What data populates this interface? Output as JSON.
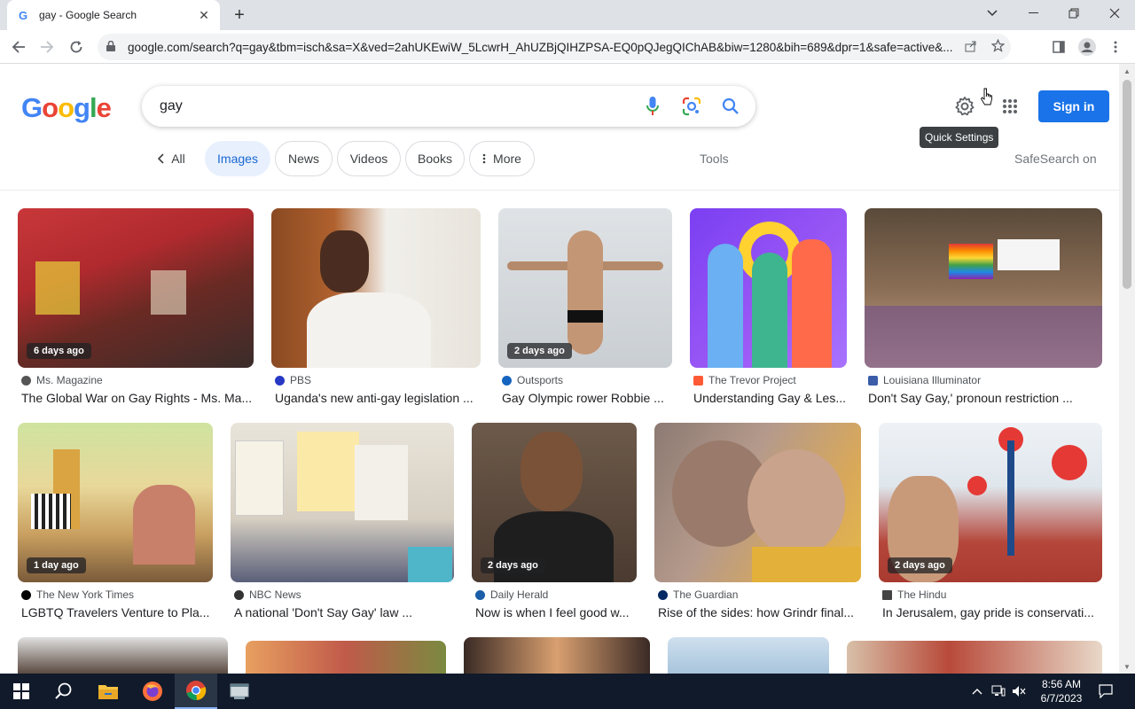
{
  "browser": {
    "tab_title": "gay - Google Search",
    "favicon": "G",
    "new_tab": "+",
    "url": "google.com/search?q=gay&tbm=isch&sa=X&ved=2ahUKEwiW_5LcwrH_AhUZBjQIHZPSA-EQ0pQJegQIChAB&biw=1280&bih=689&dpr=1&safe=active&..."
  },
  "header": {
    "logo_letters": [
      "G",
      "o",
      "o",
      "g",
      "l",
      "e"
    ],
    "logo_colors": [
      "#4285f4",
      "#ea4335",
      "#fbbc05",
      "#4285f4",
      "#34a853",
      "#ea4335"
    ],
    "search_value": "gay",
    "signin_label": "Sign in",
    "tooltip": "Quick Settings"
  },
  "filters": {
    "all": "All",
    "images": "Images",
    "news": "News",
    "videos": "Videos",
    "books": "Books",
    "more": "More",
    "tools": "Tools",
    "safesearch": "SafeSearch on"
  },
  "results": [
    {
      "age": "6 days ago",
      "source": "Ms. Magazine",
      "title": "The Global War on Gay Rights - Ms. Ma...",
      "icon_color": "#555555"
    },
    {
      "age": "",
      "source": "PBS",
      "title": "Uganda's new anti-gay legislation ...",
      "icon_color": "#2638c4"
    },
    {
      "age": "2 days ago",
      "source": "Outsports",
      "title": "Gay Olympic rower Robbie ...",
      "icon_color": "#1565c0"
    },
    {
      "age": "",
      "source": "The Trevor Project",
      "title": "Understanding Gay & Les...",
      "icon_color": "#ff5a36"
    },
    {
      "age": "",
      "source": "Louisiana Illuminator",
      "title": "Don't Say Gay,' pronoun restriction ...",
      "icon_color": "#3b5ca8"
    },
    {
      "age": "1 day ago",
      "source": "The New York Times",
      "title": "LGBTQ Travelers Venture to Pla...",
      "icon_color": "#000000"
    },
    {
      "age": "",
      "source": "NBC News",
      "title": "A national 'Don't Say Gay' law ...",
      "icon_color": "#333333"
    },
    {
      "age": "2 days ago",
      "source": "Daily Herald",
      "title": "Now is when I feel good w...",
      "icon_color": "#1a5ea8"
    },
    {
      "age": "",
      "source": "The Guardian",
      "title": "Rise of the sides: how Grindr final...",
      "icon_color": "#052962"
    },
    {
      "age": "2 days ago",
      "source": "The Hindu",
      "title": "In Jerusalem, gay pride is conservati...",
      "icon_color": "#444444"
    }
  ],
  "taskbar": {
    "time": "8:56 AM",
    "date": "6/7/2023"
  }
}
